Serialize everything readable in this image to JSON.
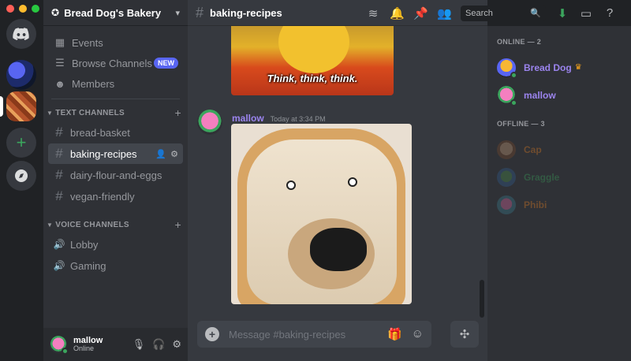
{
  "window": {
    "traffic_lights": [
      "#ff5f57",
      "#febc2e",
      "#28c840"
    ]
  },
  "servers": {
    "home_icon": "discord-logo-icon",
    "add_icon": "+",
    "explore_icon": "compass-icon"
  },
  "guild": {
    "name": "Bread Dog's Bakery"
  },
  "sidebar": {
    "nav": [
      {
        "label": "Events",
        "icon": "calendar-icon"
      },
      {
        "label": "Browse Channels",
        "icon": "browse-icon",
        "badge": "NEW"
      },
      {
        "label": "Members",
        "icon": "members-icon"
      }
    ],
    "text_category": "TEXT CHANNELS",
    "text_channels": [
      "bread-basket",
      "baking-recipes",
      "dairy-flour-and-eggs",
      "vegan-friendly"
    ],
    "active_channel": "baking-recipes",
    "voice_category": "VOICE CHANNELS",
    "voice_channels": [
      "Lobby",
      "Gaming"
    ]
  },
  "user": {
    "name": "mallow",
    "status": "Online"
  },
  "chat": {
    "channel_name": "baking-recipes",
    "image1_caption": "Think, think, think.",
    "message": {
      "author": "mallow",
      "timestamp": "Today at 3:34 PM"
    },
    "composer_placeholder": "Message #baking-recipes"
  },
  "header": {
    "search_placeholder": "Search"
  },
  "members": {
    "online_header": "ONLINE — 2",
    "online": [
      {
        "name": "Bread Dog",
        "color": "#9b84ee",
        "owner": true
      },
      {
        "name": "mallow",
        "color": "#9b84ee",
        "owner": false
      }
    ],
    "offline_header": "OFFLINE — 3",
    "offline": [
      {
        "name": "Cap",
        "color": "#e67e22"
      },
      {
        "name": "Graggle",
        "color": "#3ba55d"
      },
      {
        "name": "Phibi",
        "color": "#e67e22"
      }
    ]
  },
  "colors": {
    "accent": "#5865f2",
    "online": "#3ba55d",
    "username": "#9b84ee"
  }
}
